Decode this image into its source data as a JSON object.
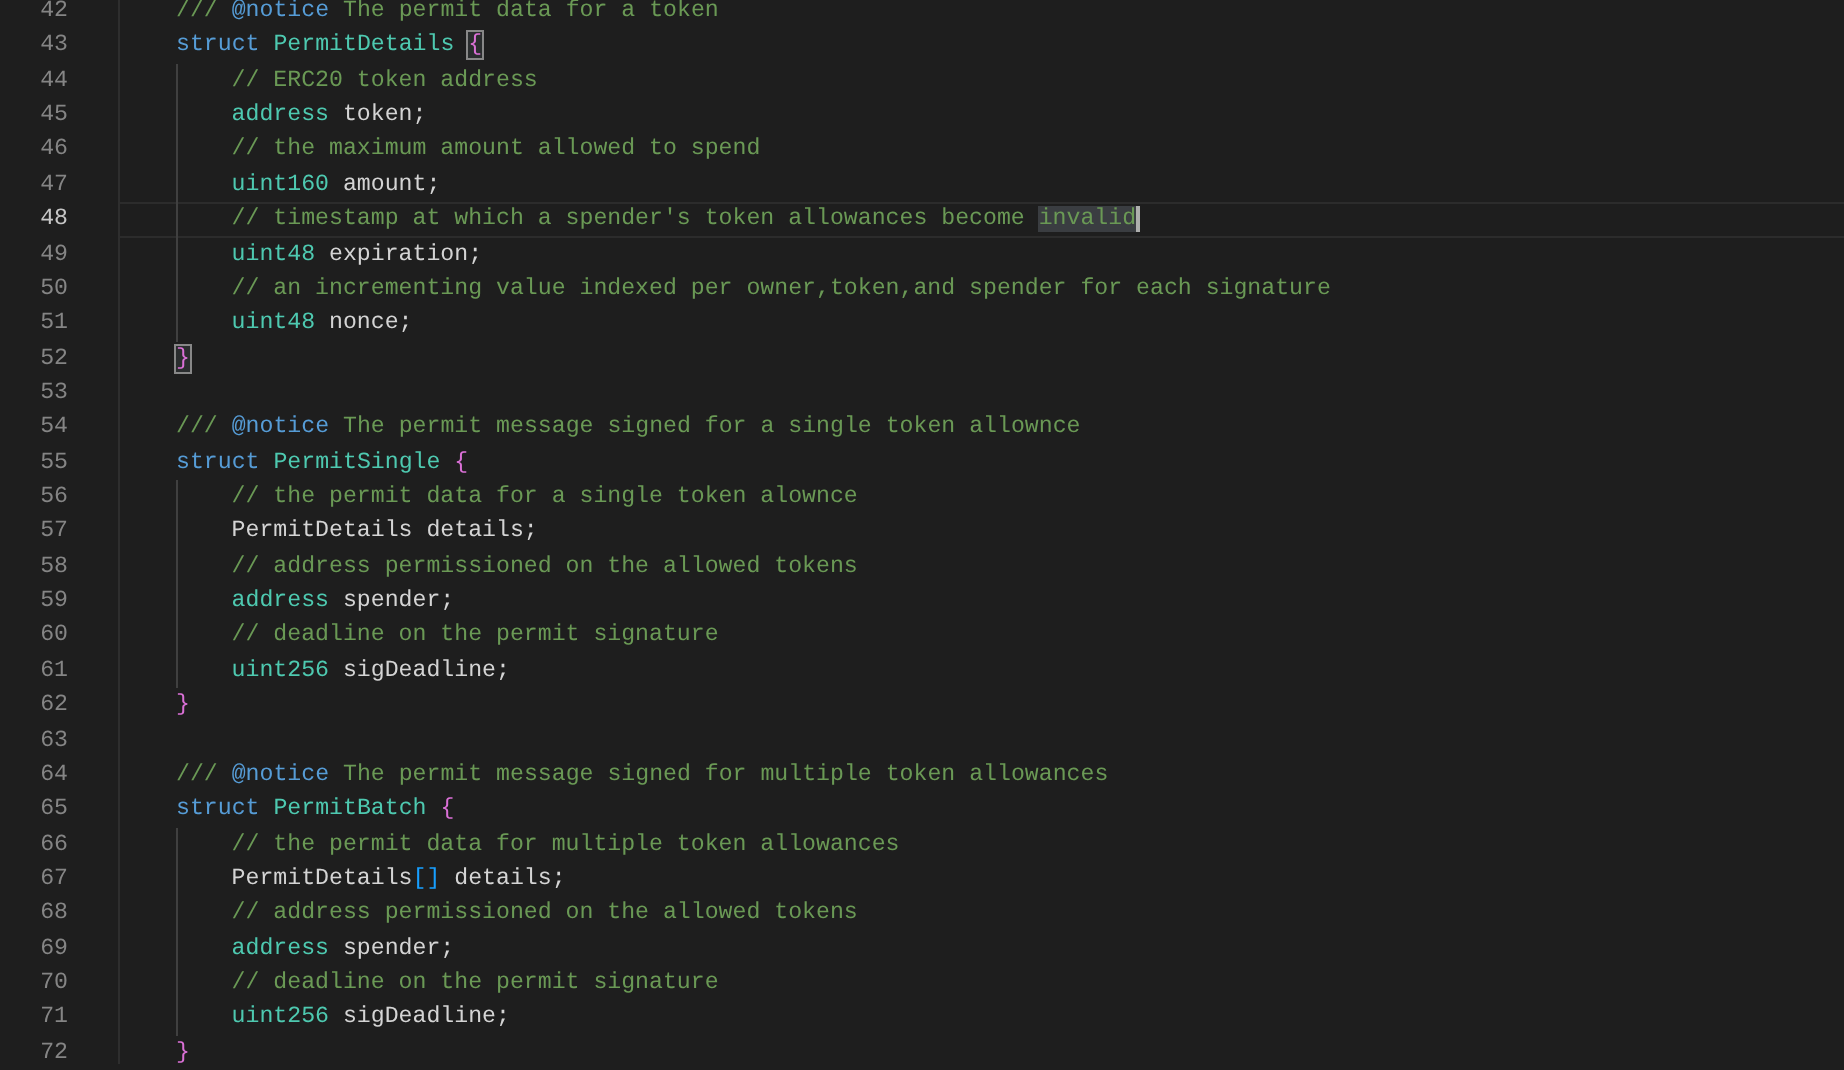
{
  "editor": {
    "lines": [
      {
        "number": "42",
        "current": false,
        "tokens": [
          {
            "kind": "comment",
            "text": "/// "
          },
          {
            "kind": "doc-tag",
            "text": "@notice"
          },
          {
            "kind": "comment",
            "text": " The permit data for a token"
          }
        ]
      },
      {
        "number": "43",
        "current": false,
        "tokens": [
          {
            "kind": "keyword",
            "text": "struct "
          },
          {
            "kind": "type",
            "text": "PermitDetails "
          },
          {
            "kind": "bracket-match",
            "text": "{"
          }
        ],
        "children": [
          {
            "number": "44",
            "current": false,
            "tokens": [
              {
                "kind": "comment",
                "text": "// ERC20 token address"
              }
            ]
          },
          {
            "number": "45",
            "current": false,
            "tokens": [
              {
                "kind": "type",
                "text": "address"
              },
              {
                "kind": "ident",
                "text": " token;"
              }
            ]
          },
          {
            "number": "46",
            "current": false,
            "tokens": [
              {
                "kind": "comment",
                "text": "// the maximum amount allowed to spend"
              }
            ]
          },
          {
            "number": "47",
            "current": false,
            "tokens": [
              {
                "kind": "type",
                "text": "uint160"
              },
              {
                "kind": "ident",
                "text": " amount;"
              }
            ]
          },
          {
            "number": "48",
            "current": true,
            "tokens": [
              {
                "kind": "comment",
                "text": "// timestamp at which a spender's token allowances become "
              },
              {
                "kind": "selection",
                "text": "invalid"
              }
            ]
          },
          {
            "number": "49",
            "current": false,
            "tokens": [
              {
                "kind": "type",
                "text": "uint48"
              },
              {
                "kind": "ident",
                "text": " expiration;"
              }
            ]
          },
          {
            "number": "50",
            "current": false,
            "tokens": [
              {
                "kind": "comment",
                "text": "// an incrementing value indexed per owner,token,and spender for each signature"
              }
            ]
          },
          {
            "number": "51",
            "current": false,
            "tokens": [
              {
                "kind": "type",
                "text": "uint48"
              },
              {
                "kind": "ident",
                "text": " nonce;"
              }
            ]
          }
        ]
      },
      {
        "number": "52",
        "current": false,
        "tokens": [
          {
            "kind": "bracket-match",
            "text": "}"
          }
        ]
      },
      {
        "number": "53",
        "current": false
      },
      {
        "number": "54",
        "current": false,
        "tokens": [
          {
            "kind": "comment",
            "text": "/// "
          },
          {
            "kind": "doc-tag",
            "text": "@notice"
          },
          {
            "kind": "comment",
            "text": " The permit message signed for a single token allownce"
          }
        ]
      },
      {
        "number": "55",
        "current": false,
        "tokens": [
          {
            "kind": "keyword",
            "text": "struct "
          },
          {
            "kind": "type",
            "text": "PermitSingle "
          },
          {
            "kind": "brace",
            "text": "{"
          }
        ],
        "children": [
          {
            "number": "56",
            "current": false,
            "tokens": [
              {
                "kind": "comment",
                "text": "// the permit data for a single token alownce"
              }
            ]
          },
          {
            "number": "57",
            "current": false,
            "tokens": [
              {
                "kind": "ident",
                "text": "PermitDetails details;"
              }
            ]
          },
          {
            "number": "58",
            "current": false,
            "tokens": [
              {
                "kind": "comment",
                "text": "// address permissioned on the allowed tokens"
              }
            ]
          },
          {
            "number": "59",
            "current": false,
            "tokens": [
              {
                "kind": "type",
                "text": "address"
              },
              {
                "kind": "ident",
                "text": " spender;"
              }
            ]
          },
          {
            "number": "60",
            "current": false,
            "tokens": [
              {
                "kind": "comment",
                "text": "// deadline on the permit signature"
              }
            ]
          },
          {
            "number": "61",
            "current": false,
            "tokens": [
              {
                "kind": "type",
                "text": "uint256"
              },
              {
                "kind": "ident",
                "text": " sigDeadline;"
              }
            ]
          }
        ]
      },
      {
        "number": "62",
        "current": false,
        "tokens": [
          {
            "kind": "brace",
            "text": "}"
          }
        ]
      },
      {
        "number": "63",
        "current": false
      },
      {
        "number": "64",
        "current": false,
        "tokens": [
          {
            "kind": "comment",
            "text": "/// "
          },
          {
            "kind": "doc-tag",
            "text": "@notice"
          },
          {
            "kind": "comment",
            "text": " The permit message signed for multiple token allowances"
          }
        ]
      },
      {
        "number": "65",
        "current": false,
        "tokens": [
          {
            "kind": "keyword",
            "text": "struct "
          },
          {
            "kind": "type",
            "text": "PermitBatch "
          },
          {
            "kind": "brace",
            "text": "{"
          }
        ],
        "children": [
          {
            "number": "66",
            "current": false,
            "tokens": [
              {
                "kind": "comment",
                "text": "// the permit data for multiple token allowances"
              }
            ]
          },
          {
            "number": "67",
            "current": false,
            "tokens": [
              {
                "kind": "ident",
                "text": "PermitDetails"
              },
              {
                "kind": "square",
                "text": "[]"
              },
              {
                "kind": "ident",
                "text": " details;"
              }
            ]
          },
          {
            "number": "68",
            "current": false,
            "tokens": [
              {
                "kind": "comment",
                "text": "// address permissioned on the allowed tokens"
              }
            ]
          },
          {
            "number": "69",
            "current": false,
            "tokens": [
              {
                "kind": "type",
                "text": "address"
              },
              {
                "kind": "ident",
                "text": " spender;"
              }
            ]
          },
          {
            "number": "70",
            "current": false,
            "tokens": [
              {
                "kind": "comment",
                "text": "// deadline on the permit signature"
              }
            ]
          },
          {
            "number": "71",
            "current": false,
            "tokens": [
              {
                "kind": "type",
                "text": "uint256"
              },
              {
                "kind": "ident",
                "text": " sigDeadline;"
              }
            ]
          }
        ]
      },
      {
        "number": "72",
        "current": false,
        "tokens": [
          {
            "kind": "brace",
            "text": "}"
          }
        ]
      }
    ]
  }
}
